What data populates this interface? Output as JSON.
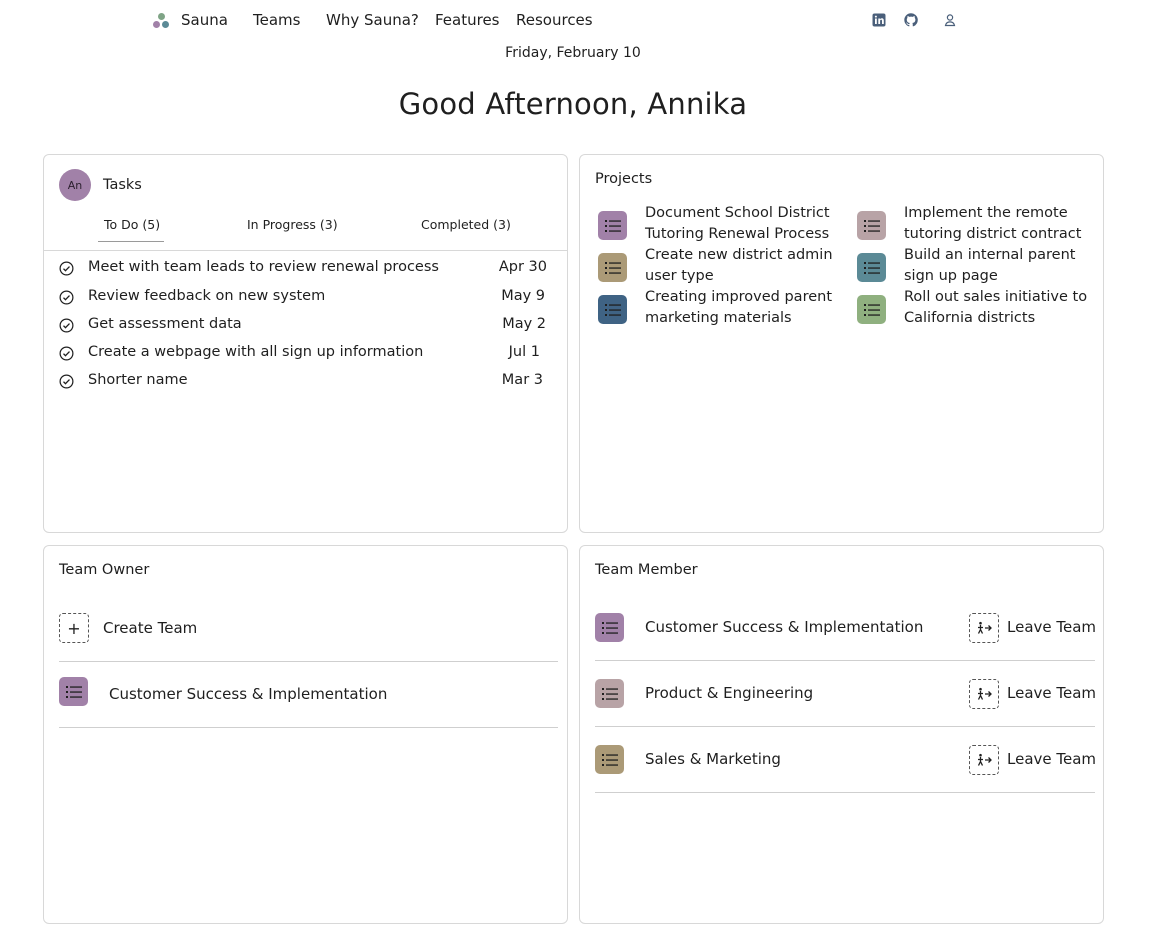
{
  "nav": {
    "brand": "Sauna",
    "links": [
      "Teams",
      "Why Sauna?",
      "Features",
      "Resources"
    ],
    "icons": [
      "linkedin-icon",
      "github-icon",
      "user-icon"
    ]
  },
  "header": {
    "date": "Friday, February 10",
    "greeting": "Good Afternoon, Annika"
  },
  "tasks": {
    "avatar_initials": "An",
    "title": "Tasks",
    "tabs": [
      {
        "label": "To Do (5)",
        "active": true
      },
      {
        "label": "In Progress (3)",
        "active": false
      },
      {
        "label": "Completed (3)",
        "active": false
      }
    ],
    "items": [
      {
        "title": "Meet with team leads to review renewal process",
        "due": "Apr 30"
      },
      {
        "title": "Review feedback on new system",
        "due": "May 9"
      },
      {
        "title": "Get assessment data",
        "due": "May 2"
      },
      {
        "title": "Create a webpage with all sign up information",
        "due": "Jul 1"
      },
      {
        "title": "Shorter name",
        "due": "Mar 3"
      }
    ]
  },
  "projects": {
    "title": "Projects",
    "items": [
      {
        "name": "Document School District Tutoring Renewal Process",
        "color": "#a181a8"
      },
      {
        "name": "Implement the remote tutoring district contract",
        "color": "#b8a3a6"
      },
      {
        "name": "Create new district admin user type",
        "color": "#ab9a77"
      },
      {
        "name": "Build an internal parent sign up page",
        "color": "#5b8a96"
      },
      {
        "name": "Creating improved parent marketing materials",
        "color": "#3f6384"
      },
      {
        "name": "Roll out sales initiative to California districts",
        "color": "#8fb07f"
      }
    ]
  },
  "team_owner": {
    "title": "Team Owner",
    "create_label": "Create Team",
    "create_icon": "+",
    "teams": [
      {
        "name": "Customer Success & Implementation",
        "color": "#a181a8"
      }
    ]
  },
  "team_member": {
    "title": "Team Member",
    "leave_label": "Leave Team",
    "teams": [
      {
        "name": "Customer Success & Implementation",
        "color": "#a181a8"
      },
      {
        "name": "Product & Engineering",
        "color": "#b8a3a6"
      },
      {
        "name": "Sales & Marketing",
        "color": "#ab9a77"
      }
    ]
  }
}
